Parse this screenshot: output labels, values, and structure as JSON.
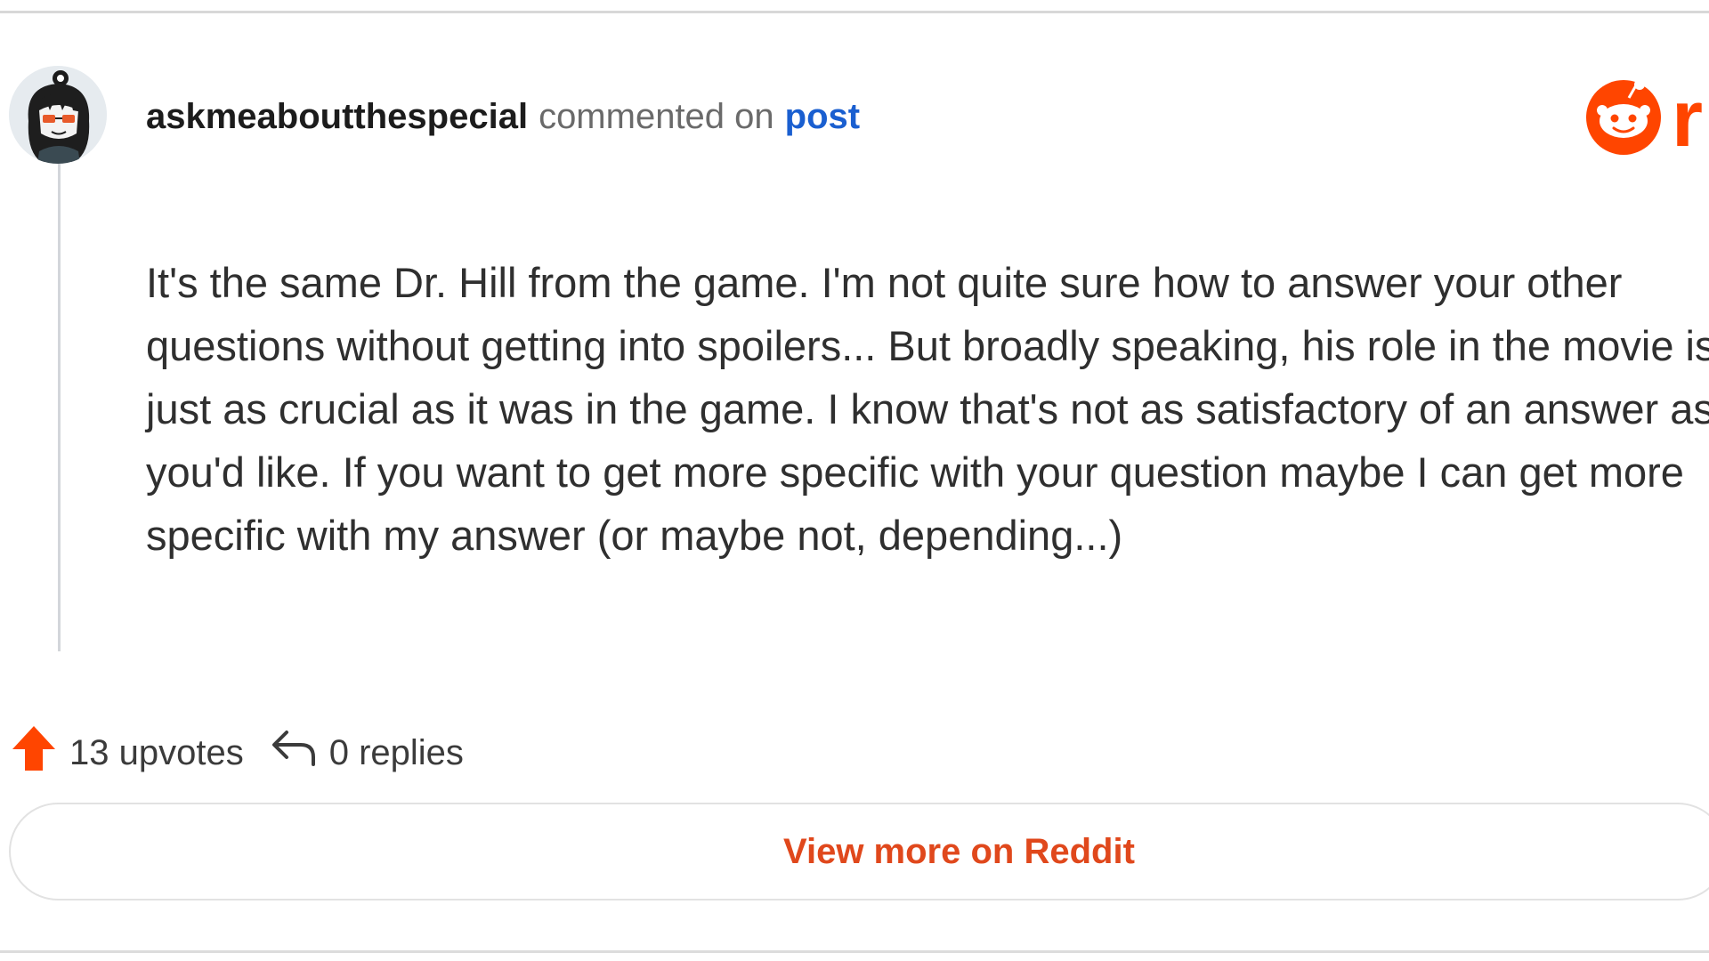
{
  "comment": {
    "username": "askmeaboutthespecial",
    "action_text": "commented on",
    "post_link": "post",
    "body_lines": [
      "It's the same Dr. Hill from the game. I'm not quite sure how to answer your other",
      "questions without getting into spoilers... But broadly speaking, his role in the movie is",
      "just as crucial as it was in the game. I know that's not as satisfactory of an answer as",
      "you'd like. If you want to get more specific with your question maybe I can get more",
      "specific with my answer (or maybe not, depending...)"
    ]
  },
  "logo": {
    "icon": "reddit-logo-icon",
    "text": "r"
  },
  "stats": {
    "upvotes": "13 upvotes",
    "replies": "0 replies",
    "upvote_icon": "upvote-arrow-icon",
    "reply_icon": "reply-arrow-icon"
  },
  "footer": {
    "view_more": "View more on Reddit"
  },
  "colors": {
    "brand_orange": "#ff4500",
    "link_blue": "#1a5fd0",
    "cta_orange": "#e0481c"
  }
}
